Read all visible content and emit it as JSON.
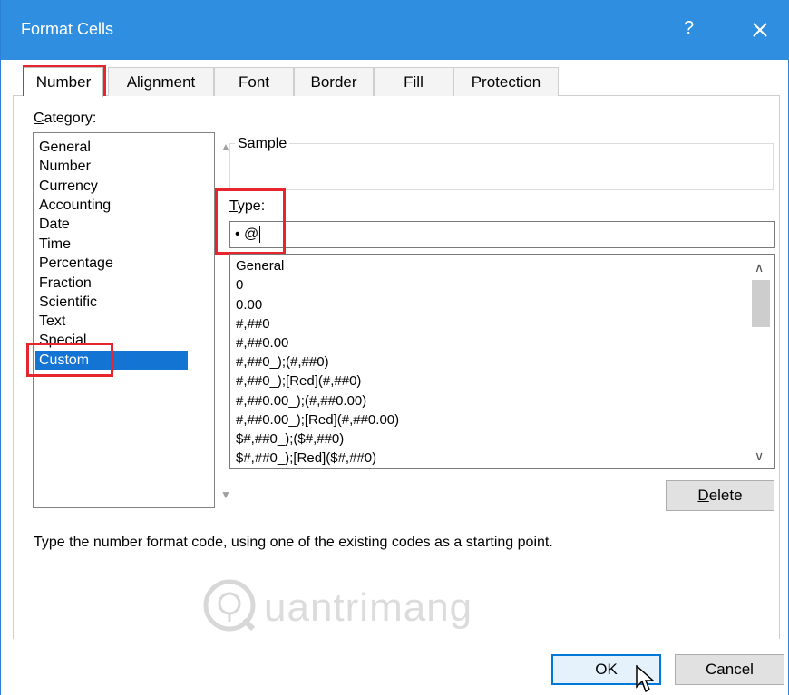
{
  "window": {
    "title": "Format Cells",
    "help_glyph": "?",
    "close_icon": "close-icon"
  },
  "tabs": [
    {
      "label": "Number",
      "active": true
    },
    {
      "label": "Alignment",
      "active": false
    },
    {
      "label": "Font",
      "active": false
    },
    {
      "label": "Border",
      "active": false
    },
    {
      "label": "Fill",
      "active": false
    },
    {
      "label": "Protection",
      "active": false
    }
  ],
  "category": {
    "label": "Category:",
    "items": [
      "General",
      "Number",
      "Currency",
      "Accounting",
      "Date",
      "Time",
      "Percentage",
      "Fraction",
      "Scientific",
      "Text",
      "Special",
      "Custom"
    ],
    "selected": "Custom"
  },
  "sample": {
    "label": "Sample"
  },
  "type": {
    "label": "Type:",
    "value": "• @"
  },
  "formats": [
    "General",
    "0",
    "0.00",
    "#,##0",
    "#,##0.00",
    "#,##0_);(#,##0)",
    "#,##0_);[Red](#,##0)",
    "#,##0.00_);(#,##0.00)",
    "#,##0.00_);[Red](#,##0.00)",
    "$#,##0_);($#,##0)",
    "$#,##0_);[Red]($#,##0)"
  ],
  "buttons": {
    "delete": {
      "prefix": "",
      "accel": "D",
      "rest": "elete"
    },
    "ok": "OK",
    "cancel": "Cancel"
  },
  "hint": "Type the number format code, using one of the existing codes as a starting point.",
  "watermark": "uantrimang",
  "colors": {
    "titlebar": "#2f8ee0",
    "selection": "#1374d4",
    "highlight": "#e8252f"
  }
}
